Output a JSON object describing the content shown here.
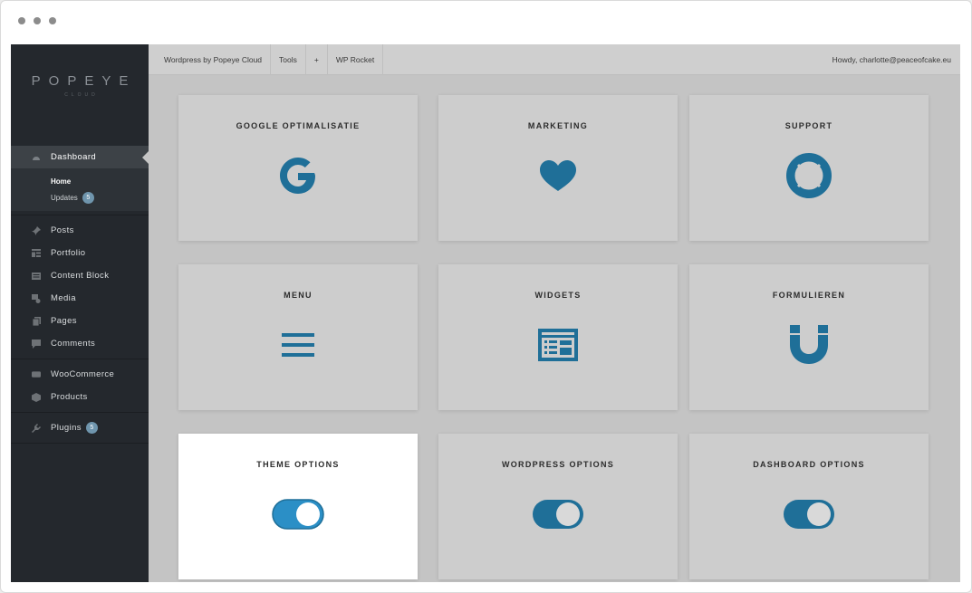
{
  "window": {
    "controls": [
      "close",
      "minimize",
      "maximize"
    ]
  },
  "brand": {
    "logo_main": "POPEYE",
    "logo_sub": "CLOUD"
  },
  "sidebar": {
    "dashboard": {
      "label": "Dashboard",
      "icon": "dashboard-icon"
    },
    "submenu": {
      "home": "Home",
      "updates": "Updates",
      "updates_count": "5"
    },
    "items": [
      {
        "label": "Posts",
        "icon": "pin-icon"
      },
      {
        "label": "Portfolio",
        "icon": "portfolio-icon"
      },
      {
        "label": "Content Block",
        "icon": "content-block-icon"
      },
      {
        "label": "Media",
        "icon": "media-icon"
      },
      {
        "label": "Pages",
        "icon": "pages-icon"
      },
      {
        "label": "Comments",
        "icon": "comments-icon"
      },
      {
        "label": "WooCommerce",
        "icon": "woocommerce-icon"
      },
      {
        "label": "Products",
        "icon": "products-icon"
      },
      {
        "label": "Plugins",
        "icon": "plugins-icon",
        "badge": "5"
      }
    ]
  },
  "topbar": {
    "site": "Wordpress by Popeye Cloud",
    "tools": "Tools",
    "plus": "+",
    "rocket": "WP Rocket",
    "greeting": "Howdy, charlotte@peaceofcake.eu"
  },
  "cards": [
    {
      "title": "GOOGLE OPTIMALISATIE",
      "icon": "google-icon"
    },
    {
      "title": "MARKETING",
      "icon": "heart-icon"
    },
    {
      "title": "SUPPORT",
      "icon": "lifebuoy-icon"
    },
    {
      "title": "MENU",
      "icon": "hamburger-menu-icon"
    },
    {
      "title": "WIDGETS",
      "icon": "widgets-icon"
    },
    {
      "title": "FORMULIEREN",
      "icon": "magnet-icon"
    },
    {
      "title": "THEME OPTIONS",
      "icon": "toggle-icon"
    },
    {
      "title": "WORDPRESS OPTIONS",
      "icon": "toggle-icon"
    },
    {
      "title": "DASHBOARD OPTIONS",
      "icon": "toggle-icon"
    }
  ],
  "colors": {
    "accent": "#1f6f98",
    "accent_active": "#2b8fc6",
    "sidebar_bg": "#24282d",
    "badge": "#6f95ad"
  }
}
